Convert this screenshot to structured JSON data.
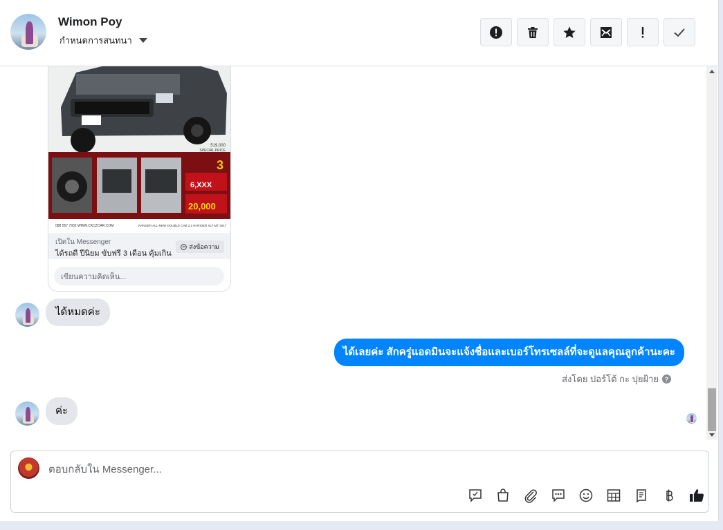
{
  "header": {
    "name": "Wimon Poy",
    "assign_label": "กำหนดการสนทนา",
    "actions": [
      {
        "icon": "alert-circle-icon",
        "label": "alert"
      },
      {
        "icon": "trash-icon",
        "label": "delete"
      },
      {
        "icon": "star-icon",
        "label": "star"
      },
      {
        "icon": "mark-unread-icon",
        "label": "mark unread"
      },
      {
        "icon": "exclamation-icon",
        "label": "spam"
      },
      {
        "icon": "check-icon",
        "label": "done"
      }
    ]
  },
  "ad_card": {
    "image_texts": {
      "price": "519,000",
      "price_caption": "SPECIAL PRICE",
      "down1": "6,XXX",
      "down2": "20,000",
      "big3": "3",
      "phone": "088 557 7932  WWW.CKCZCAR.COM",
      "model": "RANGER ALL-NEW DOUBLE CAB 2.2 HI-RIDER XLT MT 2017"
    },
    "source": "เปิดใน Messenger",
    "title": "ได้รถดี ปีนิยม ขับฟรี 3 เดือน คุ้มเกิน",
    "send_button": "ส่งข้อความ",
    "comment_placeholder": "เขียนความคิดเห็น..."
  },
  "messages": [
    {
      "direction": "in",
      "text": "ได้หมดค่ะ"
    },
    {
      "direction": "out",
      "text": "ได้เลยค่ะ สักครู่แอดมินจะแจ้งชื่อและเบอร์โทรเซลล์ที่จะดูแลคุณลูกค้านะคะ"
    },
    {
      "direction": "in",
      "text": "ค่ะ"
    }
  ],
  "sent_by": "ส่งโดย ปอร์โต้ กะ ปุยฝ้าย",
  "composer": {
    "placeholder": "ตอบกลับใน Messenger...",
    "tools": [
      "quick-reply-icon",
      "shop-bag-icon",
      "attachment-icon",
      "saved-reply-icon",
      "emoji-icon",
      "table-icon",
      "notes-icon",
      "baht-icon",
      "thumbs-up-icon"
    ]
  },
  "colors": {
    "accent": "#0084ff",
    "incoming_bubble": "#e4e6eb"
  }
}
